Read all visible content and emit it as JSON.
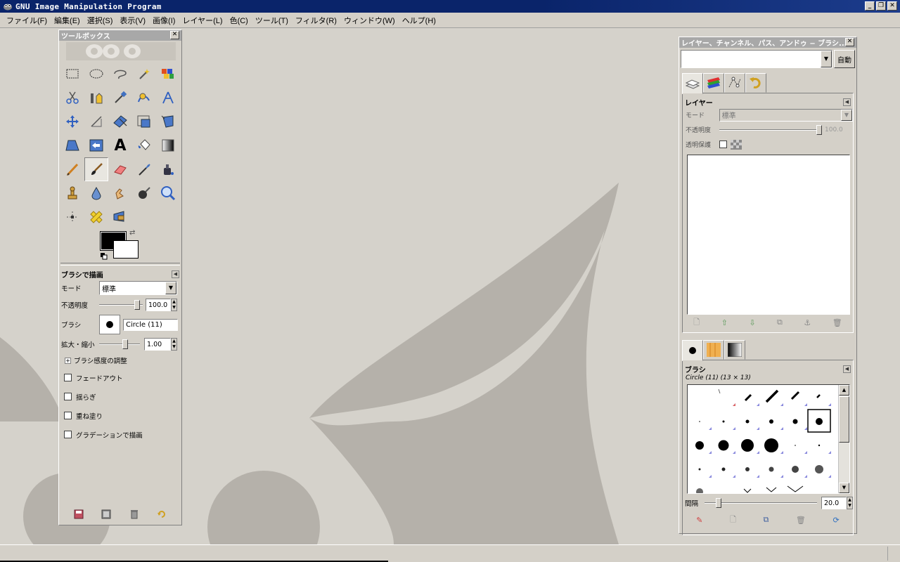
{
  "window": {
    "title": "GNU Image Manipulation Program",
    "controls": [
      "_",
      "❐",
      "✕"
    ]
  },
  "menubar": [
    "ファイル(F)",
    "編集(E)",
    "選択(S)",
    "表示(V)",
    "画像(I)",
    "レイヤー(L)",
    "色(C)",
    "ツール(T)",
    "フィルタ(R)",
    "ウィンドウ(W)",
    "ヘルプ(H)"
  ],
  "toolbox": {
    "title": "ツールボックス",
    "tools": [
      {
        "name": "rect-select-icon",
        "glyph": "▭"
      },
      {
        "name": "ellipse-select-icon",
        "glyph": "◌"
      },
      {
        "name": "free-select-icon",
        "glyph": "ᔑ"
      },
      {
        "name": "fuzzy-select-icon",
        "glyph": "✦"
      },
      {
        "name": "select-by-color-icon",
        "glyph": "▦"
      },
      {
        "name": "scissors-select-icon",
        "glyph": "✂"
      },
      {
        "name": "foreground-select-icon",
        "glyph": "♙"
      },
      {
        "name": "color-picker-tool-icon",
        "glyph": "⁄"
      },
      {
        "name": "paths-tool-icon",
        "glyph": "✎"
      },
      {
        "name": "measure-icon",
        "glyph": "⩘"
      },
      {
        "name": "move-icon",
        "glyph": "✥"
      },
      {
        "name": "align-icon",
        "glyph": "◿"
      },
      {
        "name": "crop-icon",
        "glyph": "⬓"
      },
      {
        "name": "rotate-icon",
        "glyph": "⧉"
      },
      {
        "name": "scale-icon",
        "glyph": "⬔"
      },
      {
        "name": "shear-icon",
        "glyph": "⏢"
      },
      {
        "name": "perspective-icon",
        "glyph": "⬱"
      },
      {
        "name": "flip-icon",
        "glyph": "⇆"
      },
      {
        "name": "text-icon",
        "glyph": "A"
      },
      {
        "name": "bucket-fill-icon",
        "glyph": "⛾"
      },
      {
        "name": "blend-icon",
        "glyph": "▤"
      },
      {
        "name": "pencil-icon",
        "glyph": "✏"
      },
      {
        "name": "paintbrush-icon",
        "glyph": "🖌"
      },
      {
        "name": "eraser-icon",
        "glyph": "▰"
      },
      {
        "name": "airbrush-icon",
        "glyph": "✒"
      },
      {
        "name": "ink-icon",
        "glyph": "⚱"
      },
      {
        "name": "clone-icon",
        "glyph": "♖"
      },
      {
        "name": "blur-icon",
        "glyph": "💧"
      },
      {
        "name": "smudge-icon",
        "glyph": "☝"
      },
      {
        "name": "dodge-burn-icon",
        "glyph": "◕"
      },
      {
        "name": "zoom-icon",
        "glyph": "🔍"
      },
      {
        "name": "cage-transform-icon",
        "glyph": "✛"
      },
      {
        "name": "heal-icon",
        "glyph": "✚"
      },
      {
        "name": "perspective-clone-icon",
        "glyph": "⛟"
      }
    ],
    "colors": {
      "foreground": "#000000",
      "background": "#ffffff"
    },
    "options": {
      "title": "ブラシで描画",
      "mode_label": "モード",
      "mode_value": "標準",
      "opacity_label": "不透明度",
      "opacity_value": "100.0",
      "opacity_fraction": 1.0,
      "brush_label": "ブラシ",
      "brush_value": "Circle (11)",
      "scale_label": "拡大・縮小",
      "scale_value": "1.00",
      "dynamics_label": "ブラシ感度の調整",
      "checkboxes": [
        "フェードアウト",
        "揺らぎ",
        "重ね塗り",
        "グラデーションで描画"
      ]
    },
    "bottom_icons": [
      "save-options-icon",
      "restore-options-icon",
      "delete-options-icon",
      "reset-options-icon"
    ]
  },
  "dock": {
    "title": "レイヤー、チャンネル、パス、アンドゥ − ブラシ...",
    "auto_button": "自動",
    "layers": {
      "title": "レイヤー",
      "mode_label": "モード",
      "mode_value": "標準",
      "opacity_label": "不透明度",
      "opacity_value": "100.0",
      "lock_label": "透明保護"
    },
    "brushes": {
      "title": "ブラシ",
      "selected": "Circle (11) (13 × 13)",
      "spacing_label": "間隔",
      "spacing_value": "20.0",
      "spacing_fraction": 0.2
    }
  }
}
